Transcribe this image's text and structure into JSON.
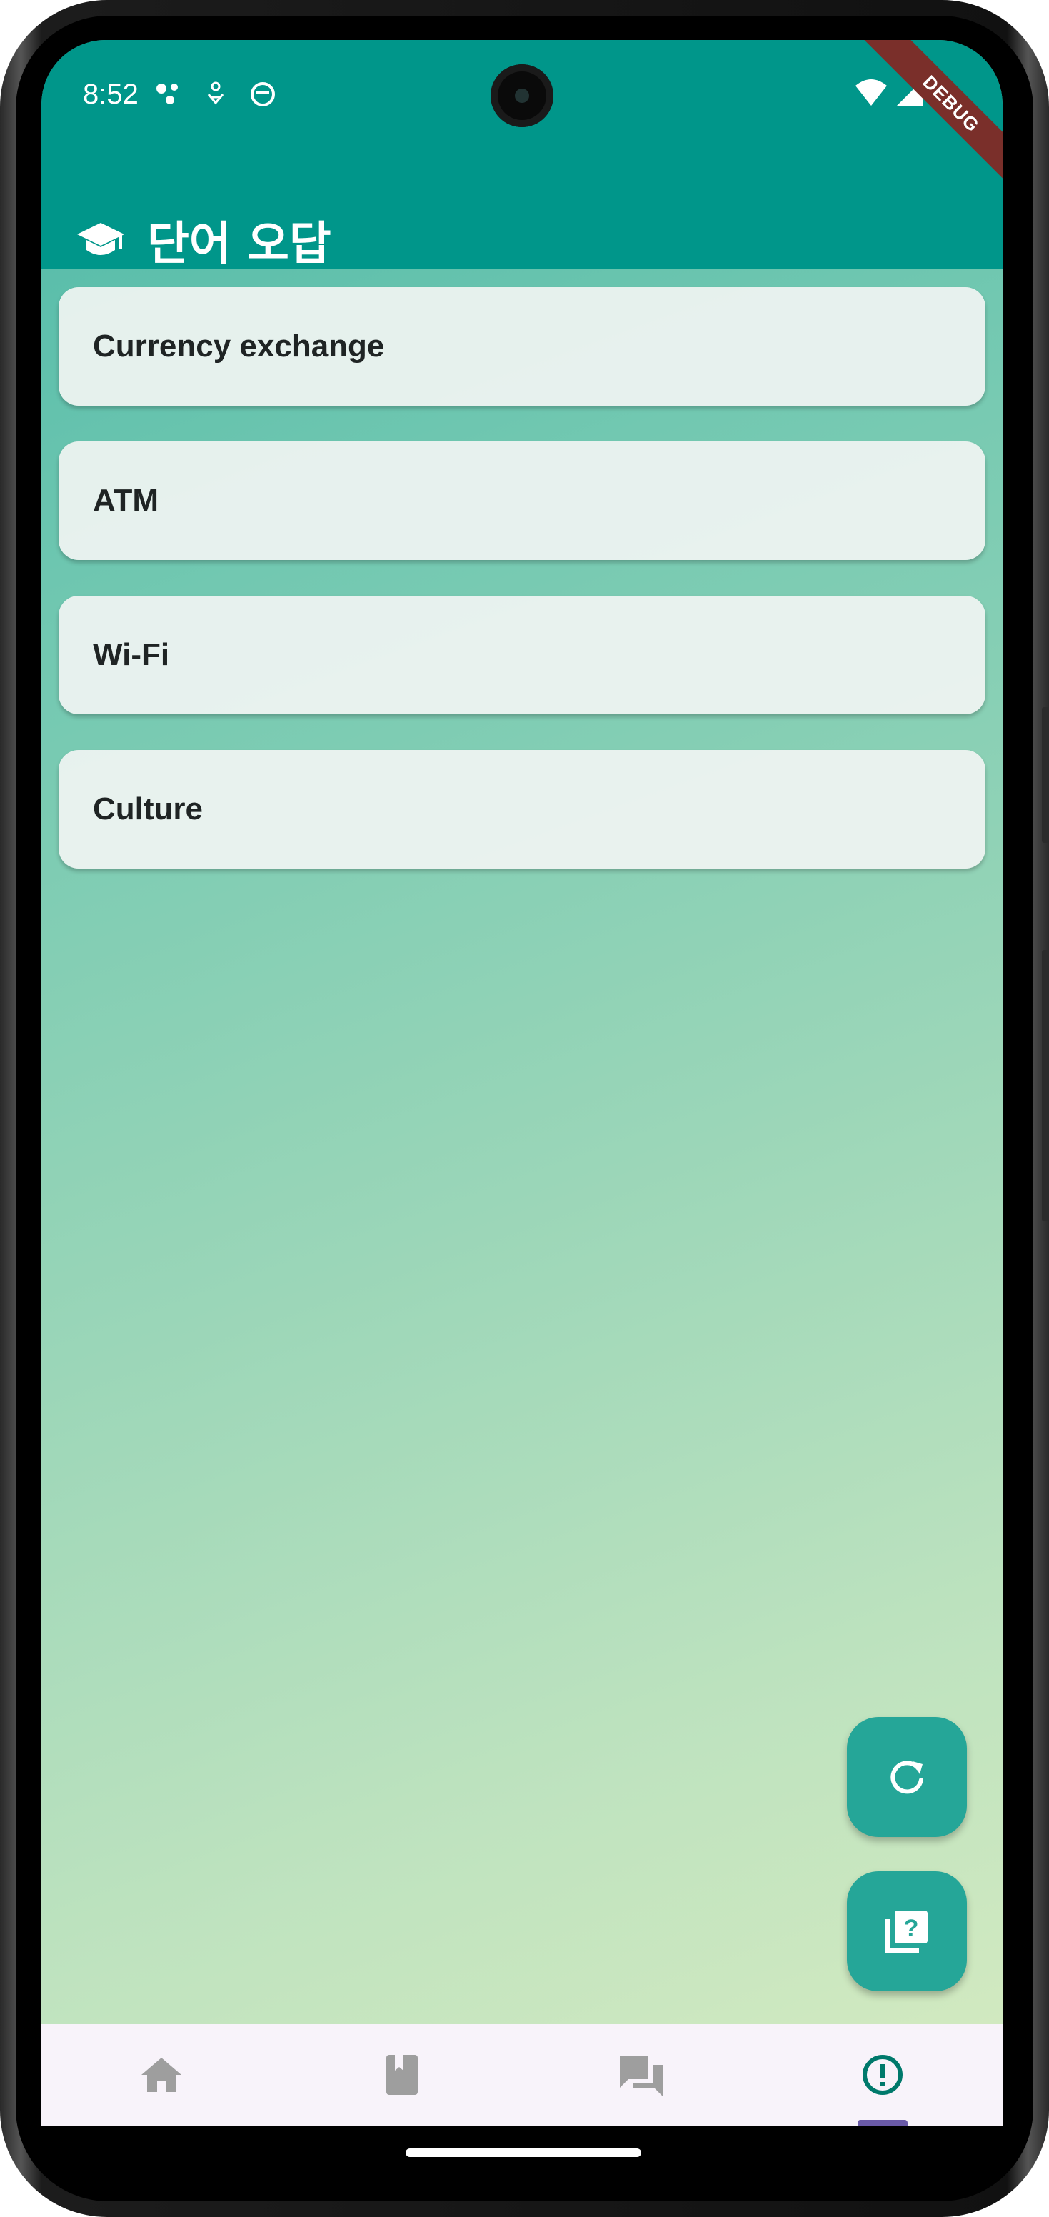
{
  "status_bar": {
    "time": "8:52",
    "debug_banner": "DEBUG"
  },
  "app_bar": {
    "title": "단어 오답",
    "icon": "graduation-cap-icon"
  },
  "words": [
    {
      "label": "Currency exchange"
    },
    {
      "label": "ATM"
    },
    {
      "label": "Wi-Fi"
    },
    {
      "label": "Culture"
    }
  ],
  "fabs": [
    {
      "icon": "refresh-icon"
    },
    {
      "icon": "quiz-icon"
    }
  ],
  "bottom_nav": {
    "items": [
      {
        "icon": "home-icon",
        "selected": false
      },
      {
        "icon": "book-icon",
        "selected": false
      },
      {
        "icon": "chat-icon",
        "selected": false
      },
      {
        "icon": "error-outline-icon",
        "selected": true
      }
    ]
  },
  "colors": {
    "app_bar": "#00968a",
    "fab": "#25a698",
    "selected_nav_icon": "#00796b",
    "unselected_nav_icon": "#9e9e9e"
  }
}
